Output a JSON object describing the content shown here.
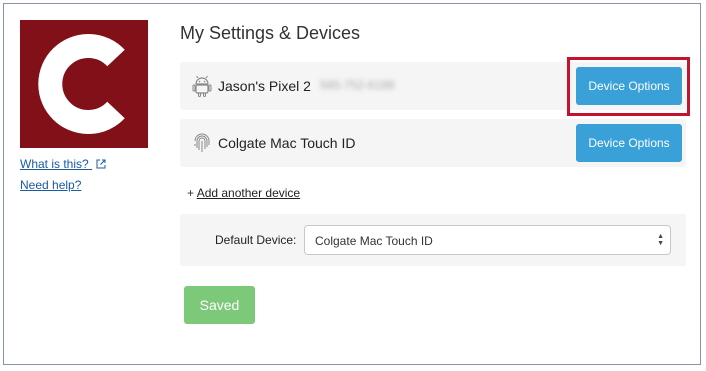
{
  "logo": {
    "letter": "C"
  },
  "sidebar": {
    "what_is_this": "What is this?",
    "need_help": "Need help?"
  },
  "page": {
    "title": "My Settings & Devices"
  },
  "devices": [
    {
      "name": "Jason's Pixel 2",
      "phone": "585-752-6188",
      "icon": "android-icon",
      "button_label": "Device Options"
    },
    {
      "name": "Colgate Mac Touch ID",
      "icon": "fingerprint-icon",
      "button_label": "Device Options"
    }
  ],
  "add_device": {
    "prefix": "+",
    "label": "Add another device"
  },
  "default_device": {
    "label": "Default Device:",
    "selected": "Colgate Mac Touch ID"
  },
  "save_button": {
    "label": "Saved",
    "color": "#7dc97a"
  },
  "colors": {
    "brand": "#821019",
    "button_blue": "#3aa0d8",
    "highlight": "#c4122f"
  }
}
